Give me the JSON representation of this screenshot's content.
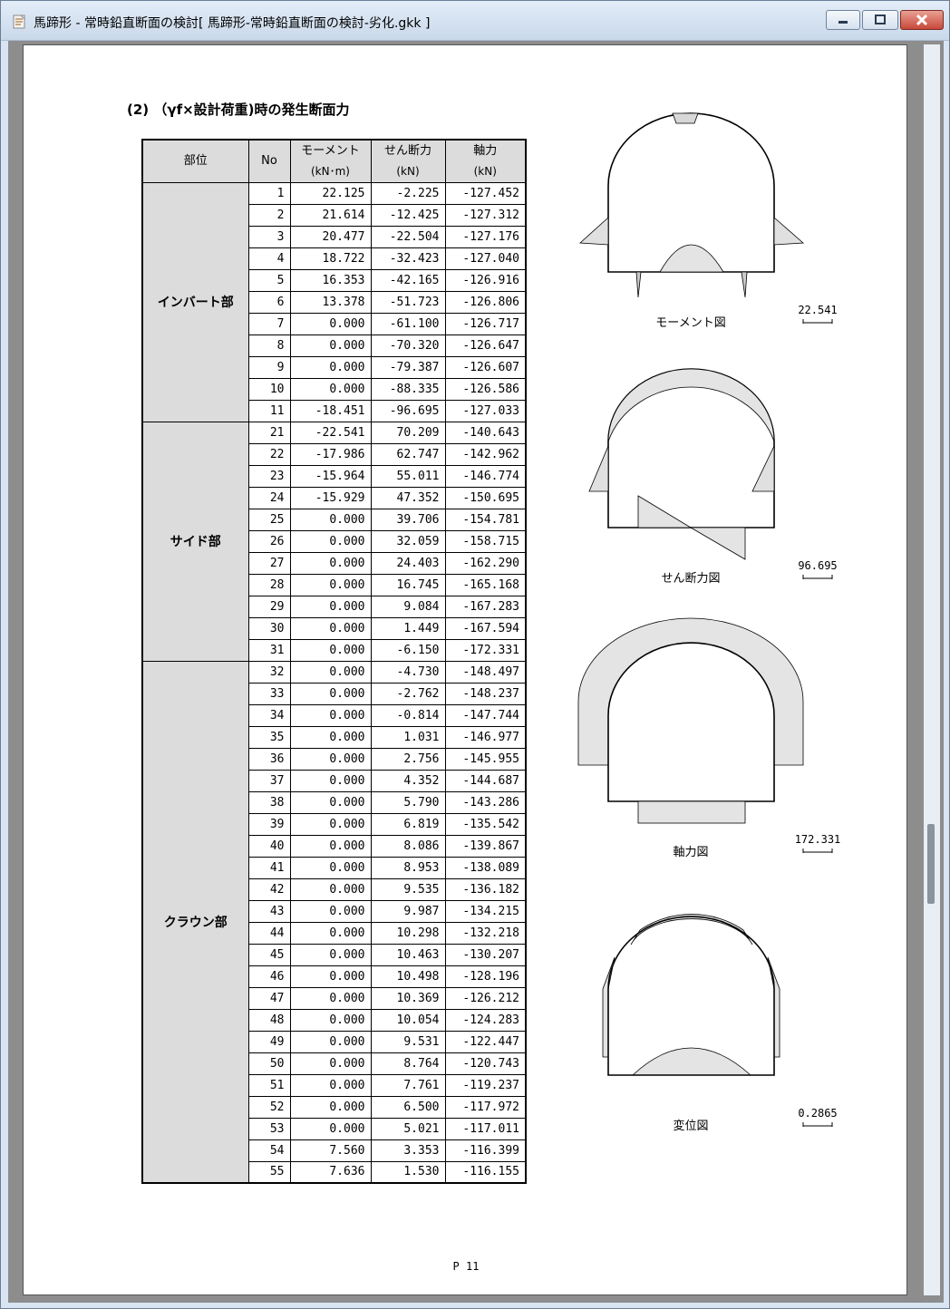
{
  "window": {
    "title": "馬蹄形 - 常時鉛直断面の検討[ 馬蹄形-常時鉛直断面の検討-劣化.gkk ]",
    "app_icon": "document-icon"
  },
  "section": {
    "heading": "(2) （γf×設計荷重)時の発生断面力"
  },
  "table": {
    "headers": {
      "part": "部位",
      "no": "No",
      "moment": "モーメント",
      "moment_unit": "(kN･m)",
      "shear": "せん断力",
      "shear_unit": "(kN)",
      "axial": "軸力",
      "axial_unit": "(kN)"
    },
    "groups": [
      {
        "name": "インバート部",
        "rows": [
          [
            "1",
            "22.125",
            "-2.225",
            "-127.452"
          ],
          [
            "2",
            "21.614",
            "-12.425",
            "-127.312"
          ],
          [
            "3",
            "20.477",
            "-22.504",
            "-127.176"
          ],
          [
            "4",
            "18.722",
            "-32.423",
            "-127.040"
          ],
          [
            "5",
            "16.353",
            "-42.165",
            "-126.916"
          ],
          [
            "6",
            "13.378",
            "-51.723",
            "-126.806"
          ],
          [
            "7",
            "0.000",
            "-61.100",
            "-126.717"
          ],
          [
            "8",
            "0.000",
            "-70.320",
            "-126.647"
          ],
          [
            "9",
            "0.000",
            "-79.387",
            "-126.607"
          ],
          [
            "10",
            "0.000",
            "-88.335",
            "-126.586"
          ],
          [
            "11",
            "-18.451",
            "-96.695",
            "-127.033"
          ]
        ]
      },
      {
        "name": "サイド部",
        "rows": [
          [
            "21",
            "-22.541",
            "70.209",
            "-140.643"
          ],
          [
            "22",
            "-17.986",
            "62.747",
            "-142.962"
          ],
          [
            "23",
            "-15.964",
            "55.011",
            "-146.774"
          ],
          [
            "24",
            "-15.929",
            "47.352",
            "-150.695"
          ],
          [
            "25",
            "0.000",
            "39.706",
            "-154.781"
          ],
          [
            "26",
            "0.000",
            "32.059",
            "-158.715"
          ],
          [
            "27",
            "0.000",
            "24.403",
            "-162.290"
          ],
          [
            "28",
            "0.000",
            "16.745",
            "-165.168"
          ],
          [
            "29",
            "0.000",
            "9.084",
            "-167.283"
          ],
          [
            "30",
            "0.000",
            "1.449",
            "-167.594"
          ],
          [
            "31",
            "0.000",
            "-6.150",
            "-172.331"
          ]
        ]
      },
      {
        "name": "クラウン部",
        "rows": [
          [
            "32",
            "0.000",
            "-4.730",
            "-148.497"
          ],
          [
            "33",
            "0.000",
            "-2.762",
            "-148.237"
          ],
          [
            "34",
            "0.000",
            "-0.814",
            "-147.744"
          ],
          [
            "35",
            "0.000",
            "1.031",
            "-146.977"
          ],
          [
            "36",
            "0.000",
            "2.756",
            "-145.955"
          ],
          [
            "37",
            "0.000",
            "4.352",
            "-144.687"
          ],
          [
            "38",
            "0.000",
            "5.790",
            "-143.286"
          ],
          [
            "39",
            "0.000",
            "6.819",
            "-135.542"
          ],
          [
            "40",
            "0.000",
            "8.086",
            "-139.867"
          ],
          [
            "41",
            "0.000",
            "8.953",
            "-138.089"
          ],
          [
            "42",
            "0.000",
            "9.535",
            "-136.182"
          ],
          [
            "43",
            "0.000",
            "9.987",
            "-134.215"
          ],
          [
            "44",
            "0.000",
            "10.298",
            "-132.218"
          ],
          [
            "45",
            "0.000",
            "10.463",
            "-130.207"
          ],
          [
            "46",
            "0.000",
            "10.498",
            "-128.196"
          ],
          [
            "47",
            "0.000",
            "10.369",
            "-126.212"
          ],
          [
            "48",
            "0.000",
            "10.054",
            "-124.283"
          ],
          [
            "49",
            "0.000",
            "9.531",
            "-122.447"
          ],
          [
            "50",
            "0.000",
            "8.764",
            "-120.743"
          ],
          [
            "51",
            "0.000",
            "7.761",
            "-119.237"
          ],
          [
            "52",
            "0.000",
            "6.500",
            "-117.972"
          ],
          [
            "53",
            "0.000",
            "5.021",
            "-117.011"
          ],
          [
            "54",
            "7.560",
            "3.353",
            "-116.399"
          ],
          [
            "55",
            "7.636",
            "1.530",
            "-116.155"
          ]
        ]
      }
    ]
  },
  "diagrams": {
    "moment": {
      "caption": "モーメント図",
      "scale": "22.541"
    },
    "shear": {
      "caption": "せん断力図",
      "scale": "96.695"
    },
    "axial": {
      "caption": "軸力図",
      "scale": "172.331"
    },
    "displacement": {
      "caption": "変位図",
      "scale": "0.2865"
    }
  },
  "page": {
    "number": "P 11"
  }
}
